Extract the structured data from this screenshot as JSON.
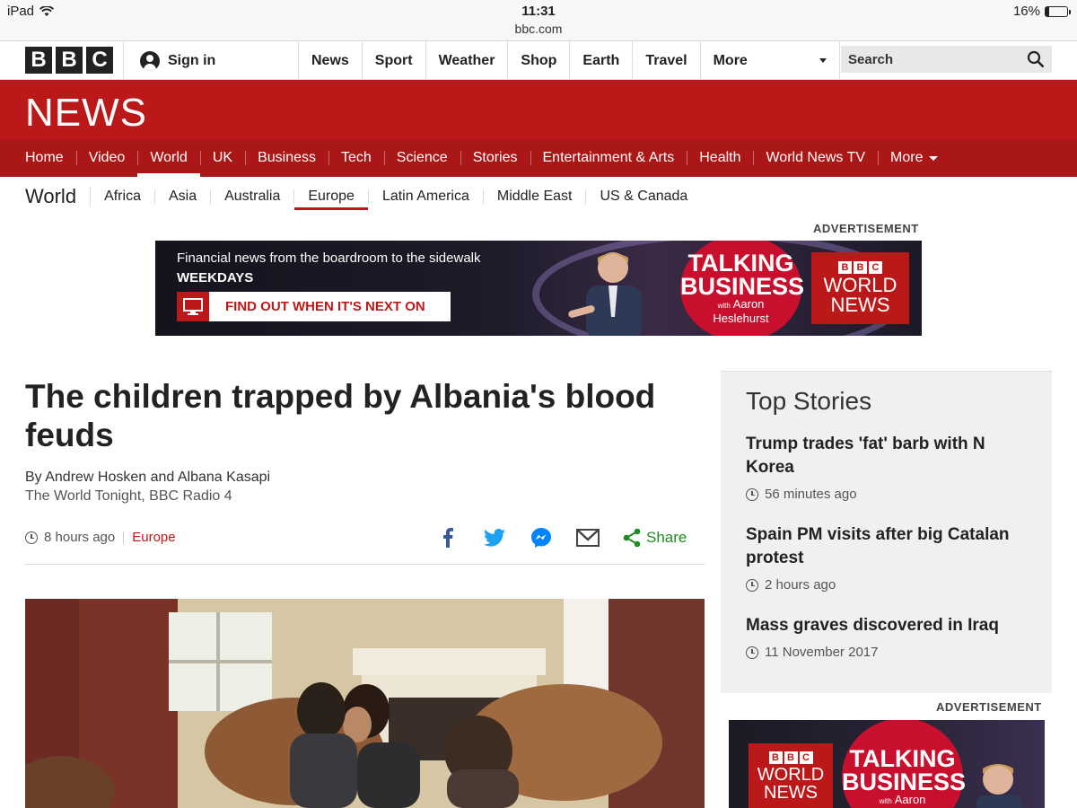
{
  "status_bar": {
    "device": "iPad",
    "time": "11:31",
    "url": "bbc.com",
    "battery": "16%",
    "battery_level": 0.16
  },
  "masthead": {
    "logo_letters": [
      "B",
      "B",
      "C"
    ],
    "sign_in": "Sign in",
    "nav": [
      "News",
      "Sport",
      "Weather",
      "Shop",
      "Earth",
      "Travel"
    ],
    "more": "More",
    "search_placeholder": "Search"
  },
  "news_logo": "NEWS",
  "main_nav": {
    "items": [
      "Home",
      "Video",
      "World",
      "UK",
      "Business",
      "Tech",
      "Science",
      "Stories",
      "Entertainment & Arts",
      "Health",
      "World News TV"
    ],
    "active": "World",
    "more": "More"
  },
  "sub_nav": {
    "section": "World",
    "items": [
      "Africa",
      "Asia",
      "Australia",
      "Europe",
      "Latin America",
      "Middle East",
      "US & Canada"
    ],
    "active": "Europe"
  },
  "advert_label": "ADVERTISEMENT",
  "advert_top": {
    "line1": "Financial news from the boardroom to the sidewalk",
    "line2": "WEEKDAYS",
    "cta": "FIND OUT WHEN IT'S NEXT ON",
    "show_line1": "TALKING",
    "show_line2": "BUSINESS",
    "show_with": "with",
    "show_host1": "Aaron",
    "show_host2": "Heslehurst",
    "brand_letters": [
      "B",
      "B",
      "C"
    ],
    "brand_line1": "WORLD",
    "brand_line2": "NEWS"
  },
  "article": {
    "headline": "The children trapped by Albania's blood feuds",
    "byline": "By Andrew Hosken and Albana Kasapi",
    "source": "The World Tonight, BBC Radio 4",
    "time": "8 hours ago",
    "tag": "Europe",
    "share_label": "Share"
  },
  "top_stories": {
    "title": "Top Stories",
    "items": [
      {
        "headline": "Trump trades 'fat' barb with N Korea",
        "time": "56 minutes ago"
      },
      {
        "headline": "Spain PM visits after big Catalan protest",
        "time": "2 hours ago"
      },
      {
        "headline": "Mass graves discovered in Iraq",
        "time": "11 November 2017"
      }
    ]
  },
  "colors": {
    "bbc_red": "#bb1919",
    "nav_red": "#a91717",
    "share_green": "#1f8d22"
  }
}
